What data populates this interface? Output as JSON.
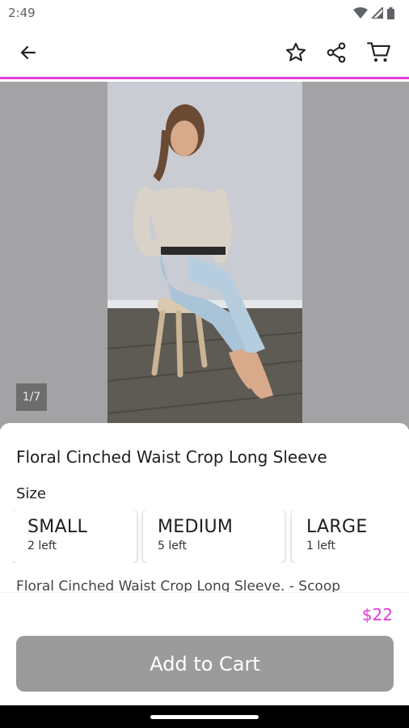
{
  "status_bar": {
    "time": "2:49",
    "icons": [
      "wifi-icon",
      "signal-icon",
      "battery-icon"
    ]
  },
  "app_bar": {
    "icons": [
      "back-arrow-icon",
      "star-icon",
      "share-icon",
      "cart-icon"
    ],
    "accent_color": "#e23ad9"
  },
  "gallery": {
    "counter": "1/7",
    "image_description_icon": "product-photo"
  },
  "product": {
    "title": "Floral Cinched Waist Crop Long Sleeve",
    "size_label": "Size",
    "sizes": [
      {
        "name": "SMALL",
        "stock": "2 left"
      },
      {
        "name": "MEDIUM",
        "stock": "5 left"
      },
      {
        "name": "LARGE",
        "stock": "1 left"
      }
    ],
    "description": "Floral Cinched Waist Crop Long Sleeve. - Scoop",
    "price": "$22",
    "price_color": "#e23ad9",
    "add_to_cart_label": "Add to Cart"
  }
}
